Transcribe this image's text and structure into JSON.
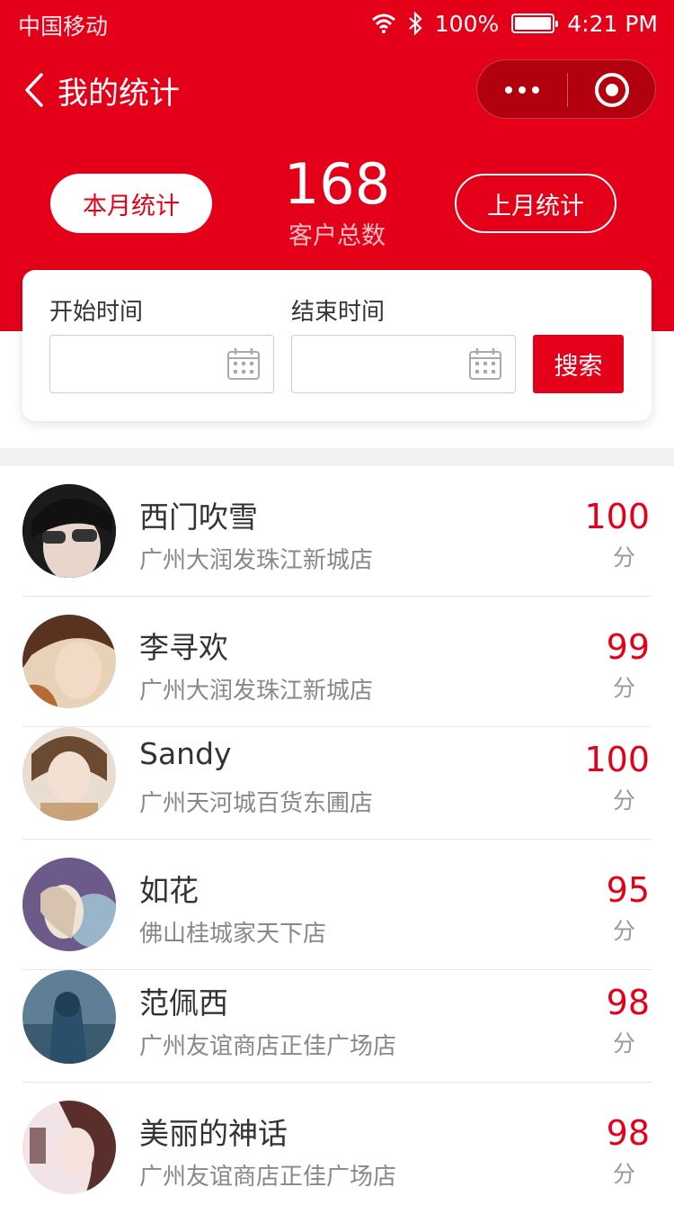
{
  "status_bar": {
    "carrier": "中国移动",
    "battery": "100%",
    "time": "4:21 PM"
  },
  "nav": {
    "title": "我的统计"
  },
  "summary": {
    "this_month_label": "本月统计",
    "last_month_label": "上月统计",
    "total_count": "168",
    "total_label": "客户总数"
  },
  "filter": {
    "start_label": "开始时间",
    "end_label": "结束时间",
    "start_value": "",
    "end_value": "",
    "search_label": "搜索"
  },
  "customers": [
    {
      "name": "西门吹雪",
      "store": "广州大润发珠江新城店",
      "score": "100",
      "unit": "分"
    },
    {
      "name": "李寻欢",
      "store": "广州大润发珠江新城店",
      "score": "99",
      "unit": "分"
    },
    {
      "name": "Sandy",
      "store": "广州天河城百货东圃店",
      "score": "100",
      "unit": "分"
    },
    {
      "name": "如花",
      "store": "佛山桂城家天下店",
      "score": "95",
      "unit": "分"
    },
    {
      "name": "范佩西",
      "store": "广州友谊商店正佳广场店",
      "score": "98",
      "unit": "分"
    },
    {
      "name": "美丽的神话",
      "store": "广州友谊商店正佳广场店",
      "score": "98",
      "unit": "分"
    }
  ],
  "colors": {
    "brand": "#e5001a",
    "text": "#333333",
    "muted": "#888888"
  }
}
